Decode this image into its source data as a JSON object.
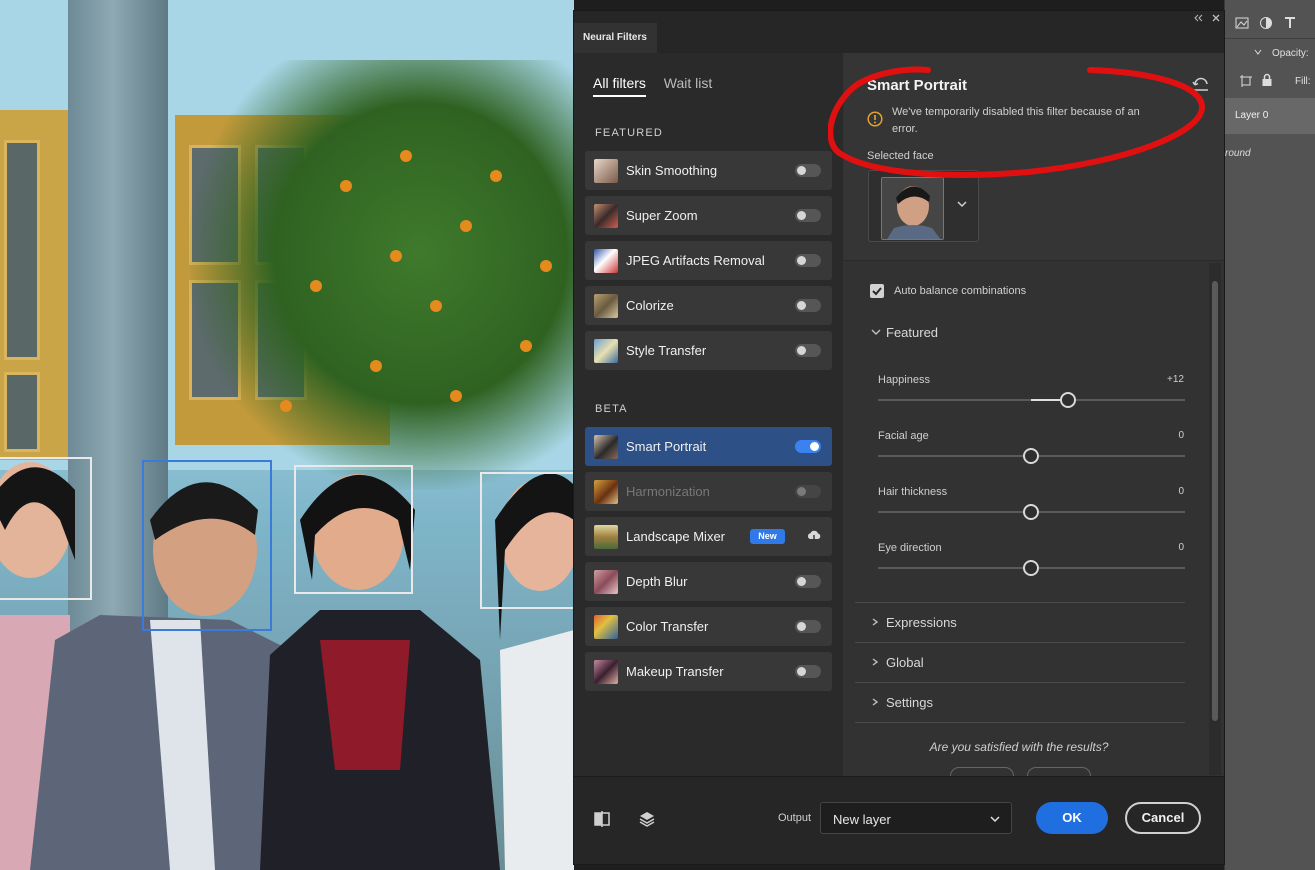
{
  "dialog": {
    "tab_label": "Neural Filters",
    "subtabs": [
      "All filters",
      "Wait list"
    ],
    "featured_label": "FEATURED",
    "beta_label": "BETA",
    "featured": [
      {
        "name": "Skin Smoothing",
        "state": "off"
      },
      {
        "name": "Super Zoom",
        "state": "off"
      },
      {
        "name": "JPEG Artifacts Removal",
        "state": "off"
      },
      {
        "name": "Colorize",
        "state": "off"
      },
      {
        "name": "Style Transfer",
        "state": "off"
      }
    ],
    "beta": [
      {
        "name": "Smart Portrait",
        "state": "on"
      },
      {
        "name": "Harmonization",
        "state": "disabled"
      },
      {
        "name": "Landscape Mixer",
        "state": "download",
        "badge": "New"
      },
      {
        "name": "Depth Blur",
        "state": "off"
      },
      {
        "name": "Color Transfer",
        "state": "off"
      },
      {
        "name": "Makeup Transfer",
        "state": "off"
      }
    ]
  },
  "detail": {
    "title": "Smart Portrait",
    "warning": "We've temporarily disabled this filter because of an error.",
    "selected_face_label": "Selected face",
    "auto_balance_label": "Auto balance combinations",
    "featured_group": "Featured",
    "sliders": [
      {
        "label": "Happiness",
        "value_text": "+12",
        "value": 12
      },
      {
        "label": "Facial age",
        "value_text": "0",
        "value": 0
      },
      {
        "label": "Hair thickness",
        "value_text": "0",
        "value": 0
      },
      {
        "label": "Eye direction",
        "value_text": "0",
        "value": 0
      }
    ],
    "collapsed_groups": [
      "Expressions",
      "Global",
      "Settings"
    ],
    "satisfied_text": "Are you satisfied with the results?"
  },
  "footer": {
    "output_label": "Output",
    "output_value": "New layer",
    "ok_label": "OK",
    "cancel_label": "Cancel"
  },
  "ps_panel": {
    "opacity_label": "Opacity:",
    "fill_label": "Fill:",
    "layer0": "Layer 0",
    "background_partial": "round"
  },
  "colors": {
    "accent": "#1f6fe0",
    "active_item": "#2d5187",
    "warning": "#e0a030",
    "annotation": "#e01010"
  }
}
